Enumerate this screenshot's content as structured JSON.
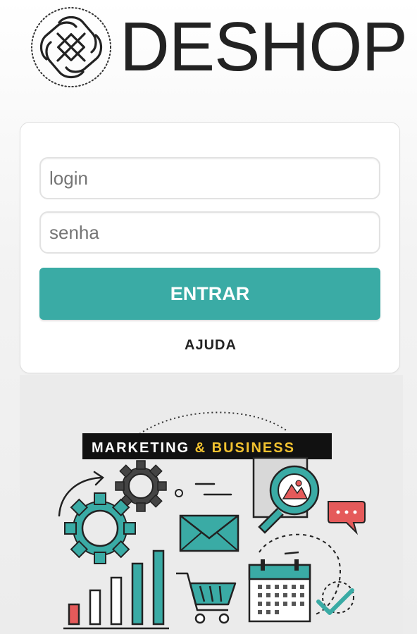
{
  "brand": {
    "name": "DESHOP",
    "logo_icon": "knot-logo-icon"
  },
  "login_form": {
    "login_placeholder": "login",
    "login_value": "",
    "password_placeholder": "senha",
    "password_value": "",
    "submit_label": "ENTRAR",
    "help_label": "AJUDA"
  },
  "banner": {
    "title_part1": "MARKETING ",
    "title_amp": "& ",
    "title_part2": "BUSINESS",
    "icons": [
      "gear-icon",
      "envelope-icon",
      "magnifier-icon",
      "chat-bubble-icon",
      "calendar-icon",
      "shopping-cart-icon",
      "bar-chart-icon",
      "checkmark-icon",
      "arrow-icon"
    ]
  },
  "colors": {
    "accent": "#3aaba5",
    "banner_title_bg": "#111111",
    "banner_highlight": "#f2c230",
    "chat_red": "#e55a5a"
  }
}
